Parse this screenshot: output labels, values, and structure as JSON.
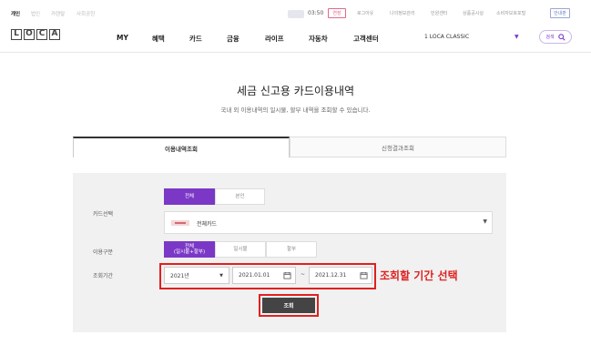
{
  "top_bar": {
    "segments": [
      "개인",
      "법인",
      "카렌탈",
      "사회공헌"
    ],
    "active_segment": "개인",
    "timer": "03:50",
    "extend_label": "연장",
    "links": [
      "로그아웃",
      "나의정보관리",
      "민원센터",
      "상품공시실",
      "소비자보호포털"
    ],
    "guide_label": "안내판"
  },
  "logo": {
    "letters": [
      "L",
      "O",
      "C",
      "A"
    ]
  },
  "gnb": {
    "items": [
      "MY",
      "혜택",
      "카드",
      "금융",
      "라이프",
      "자동차",
      "고객센터"
    ]
  },
  "card_selector": {
    "value": "1  LOCA CLASSIC"
  },
  "search": {
    "label": "검색"
  },
  "page": {
    "title": "세금 신고용 카드이용내역",
    "subtitle": "국내 외 이용내역의 일시불, 할부 내역을 조회할 수 있습니다."
  },
  "tabs": [
    {
      "label": "이용내역조회",
      "active": true
    },
    {
      "label": "신청결과조회",
      "active": false
    }
  ],
  "form": {
    "card_select_label": "카드선택",
    "scope_options": [
      "전체",
      "본인"
    ],
    "scope_selected": "전체",
    "card_value": "전체카드",
    "usage_label": "이용구분",
    "usage_options": [
      {
        "line1": "전체",
        "line2": "(일시불+할부)"
      },
      {
        "line1": "일시불",
        "line2": ""
      },
      {
        "line1": "할부",
        "line2": ""
      }
    ],
    "period_label": "조회기간",
    "year_value": "2021년",
    "start_date": "2021.01.01",
    "end_date": "2021.12.31",
    "tilde": "~",
    "annotation": "조회할 기간 선택",
    "query_label": "조회"
  },
  "colors": {
    "accent": "#7b38c6",
    "highlight": "#e02020"
  }
}
